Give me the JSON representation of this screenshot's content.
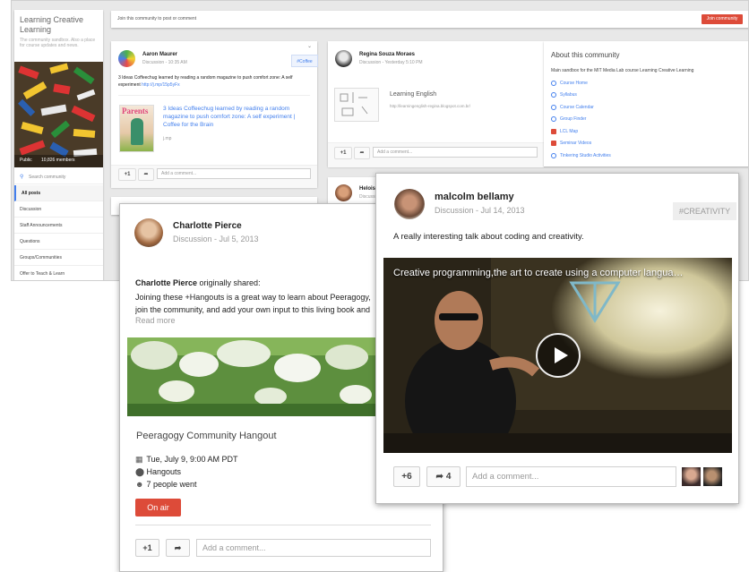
{
  "sidebar": {
    "title": "Learning Creative Learning",
    "description": "The community sandbox. Also a place for course updates and news.",
    "visibility": "Public",
    "members": "10,826 members",
    "search_placeholder": "Search community",
    "nav": [
      "All posts",
      "Discussion",
      "Staff Announcements",
      "Questions",
      "Groups/Communities",
      "Offer to Teach & Learn"
    ]
  },
  "topbar": {
    "prompt": "Join this community to post or comment",
    "join_label": "Join community"
  },
  "post1": {
    "author": "Aaron Maurer",
    "meta": "Discussion  -  10:35 AM",
    "tag": "#Coffee",
    "text": "3 Ideas Coffeechug learned by reading a random magazine to push comfort zone: A self experiment",
    "link_short": "http://j.mp/15p5yFx",
    "link_title": "3 Ideas Coffeechug learned by reading a random magazine to push comfort zone: A self experiment | Coffee for the Brain",
    "domain": "j.mp",
    "plus": "+1",
    "comment_placeholder": "Add a comment...",
    "thumb_label": "Parents"
  },
  "post2": {
    "author": "Regina Souza Moraes",
    "meta": "Discussion  -  Yesterday 5:10 PM",
    "link_title": "Learning English",
    "link_url": "http://learningenglish-regina.blogspot.com.br/",
    "plus": "+1",
    "comment_placeholder": "Add a comment..."
  },
  "post3": {
    "author": "Heloisa",
    "meta": "Discussi"
  },
  "about": {
    "title": "About this community",
    "description": "Main sandbox for the MIT Media Lab course Learning Creative Learning",
    "links": [
      "Course Home",
      "Syllabus",
      "Course Calendar",
      "Group Finder",
      "LCL Map",
      "Seminar Videos",
      "Tinkering Studio Activities"
    ]
  },
  "charlotte": {
    "author": "Charlotte Pierce",
    "meta": "Discussion  -  Jul 5, 2013",
    "shared_name": "Charlotte Pierce",
    "shared_suffix": " originally shared:",
    "text": "Joining these +Hangouts is a great way to learn about Peeragogy, join the community, and add your own input to this living book and project. Add",
    "read_more": "Read more",
    "event_title": "Peeragogy Community Hangout",
    "event_date": "Tue, July 9, 9:00 AM PDT",
    "event_type": "Hangouts",
    "event_attendance": "7 people went",
    "on_air": "On air",
    "plus": "+1",
    "comment_placeholder": "Add a comment..."
  },
  "malcolm": {
    "author": "malcolm bellamy",
    "meta": "Discussion  -  Jul 14, 2013",
    "tag": "#CREATIVITY",
    "text": "A really interesting talk about coding and creativity.",
    "video_title": "Creative programming,the art to create using a computer langua…",
    "plus": "+6",
    "shares": "4",
    "comment_placeholder": "Add a comment..."
  },
  "colors": {
    "accent": "#dd4b39",
    "link": "#427fed",
    "tag_bg": "#eeeeee"
  },
  "icons": [
    "search-icon",
    "share-icon",
    "calendar-icon",
    "location-icon",
    "person-icon",
    "play-icon",
    "chevron-down-icon",
    "youtube-icon",
    "gplus-icon",
    "link-icon"
  ]
}
